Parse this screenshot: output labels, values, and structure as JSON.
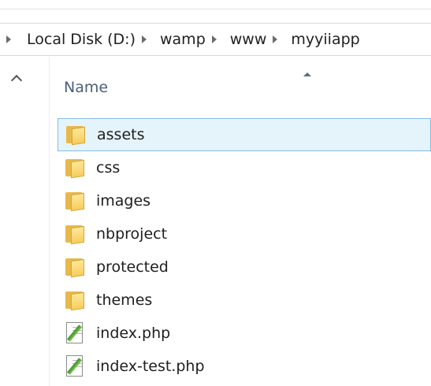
{
  "breadcrumb": {
    "items": [
      {
        "label": "Local Disk (D:)"
      },
      {
        "label": "wamp"
      },
      {
        "label": "www"
      },
      {
        "label": "myyiiapp"
      }
    ]
  },
  "column_header": {
    "name_label": "Name",
    "sort_direction": "ascending"
  },
  "files": [
    {
      "name": "assets",
      "type": "folder",
      "selected": true
    },
    {
      "name": "css",
      "type": "folder",
      "selected": false
    },
    {
      "name": "images",
      "type": "folder",
      "selected": false
    },
    {
      "name": "nbproject",
      "type": "folder",
      "selected": false
    },
    {
      "name": "protected",
      "type": "folder",
      "selected": false
    },
    {
      "name": "themes",
      "type": "folder",
      "selected": false
    },
    {
      "name": "index.php",
      "type": "php-file",
      "selected": false
    },
    {
      "name": "index-test.php",
      "type": "php-file",
      "selected": false
    }
  ],
  "colors": {
    "selection_background": "#e5f3fb",
    "selection_border": "#84bbe5",
    "header_text": "#4c607a",
    "folder_yellow": "#f6cd5b"
  }
}
